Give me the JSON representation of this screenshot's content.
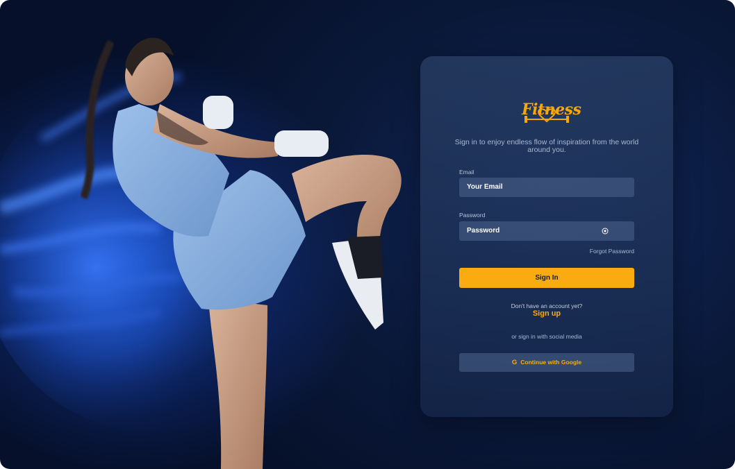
{
  "brand": {
    "logo_text": "Fitness",
    "tagline": "Sign in to enjoy endless flow of inspiration from the world around you."
  },
  "form": {
    "email_label": "Email",
    "email_placeholder": "Your Email",
    "password_label": "Password",
    "password_placeholder": "Password",
    "forgot_password": "Forgot Password",
    "sign_in_button": "Sign In"
  },
  "signup": {
    "prompt": "Don't have an account yet?",
    "link": "Sign up"
  },
  "social": {
    "prompt": "or sign in with social media",
    "google_icon": "G",
    "google_button": "Continue with Google"
  },
  "colors": {
    "accent": "#fbab12",
    "background": "#0a1838",
    "card": "#22365c"
  },
  "icons": {
    "password_toggle": "eye-icon",
    "google": "google-icon",
    "logo_heart": "heart-dumbbell-icon"
  }
}
